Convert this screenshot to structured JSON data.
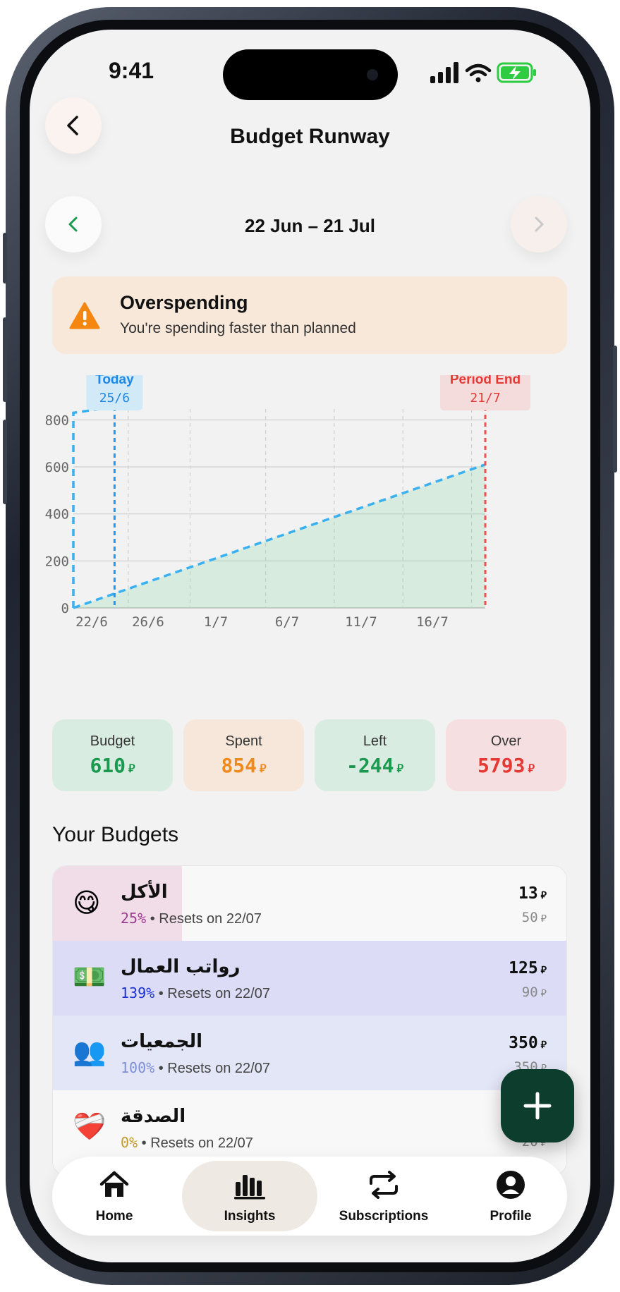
{
  "status_bar": {
    "time": "9:41"
  },
  "header": {
    "title": "Budget Runway"
  },
  "period": {
    "label": "22 Jun – 21 Jul"
  },
  "alert": {
    "title": "Overspending",
    "message": "You're spending faster than planned",
    "color": "#f8e8da"
  },
  "chart_data": {
    "type": "line",
    "x_ticks": [
      "22/6",
      "26/6",
      "1/7",
      "6/7",
      "11/7",
      "16/7"
    ],
    "y_ticks": [
      0,
      200,
      400,
      600,
      800
    ],
    "ylim": [
      0,
      900
    ],
    "markers": {
      "today": {
        "label": "Today",
        "date": "25/6"
      },
      "period_end": {
        "label": "Period End",
        "date": "21/7"
      }
    },
    "series": [
      {
        "values": [
          [
            0,
            0
          ],
          [
            30,
            610
          ]
        ],
        "color": "#3bb0f0",
        "style": "dashed-area"
      },
      {
        "values": [
          [
            0,
            830
          ],
          [
            3,
            855
          ]
        ],
        "color": "#3bb0f0",
        "style": "dashed"
      }
    ]
  },
  "stats": [
    {
      "label": "Budget",
      "value": "610",
      "currency": "⃁",
      "color": "#1a9a4f",
      "bg": "#d8ece2"
    },
    {
      "label": "Spent",
      "value": "854",
      "currency": "⃁",
      "color": "#f08a1c",
      "bg": "#f6e7da"
    },
    {
      "label": "Left",
      "value": "-244",
      "currency": "⃁",
      "color": "#1a9a4f",
      "bg": "#d8ece2"
    },
    {
      "label": "Over",
      "value": "5793",
      "currency": "⃁",
      "color": "#e53935",
      "bg": "#f5dfe0"
    }
  ],
  "budgets_section": {
    "title": "Your Budgets"
  },
  "budgets": [
    {
      "emoji": "😋",
      "name": "الأكل",
      "percent": "25%",
      "percent_color": "#9b3c8f",
      "resets": "• Resets on 22/07",
      "spent": "13",
      "budget": "50",
      "fill": 0.25,
      "fill_color": "#f1dde8",
      "bg": "#f8f8f8"
    },
    {
      "emoji": "💵",
      "name": "رواتب العمال",
      "percent": "139%",
      "percent_color": "#1a2fd6",
      "resets": "• Resets on 22/07",
      "spent": "125",
      "budget": "90",
      "fill": 1.0,
      "fill_color": "#dcdcf6",
      "bg": "#dcdcf6"
    },
    {
      "emoji": "👥",
      "name": "الجمعيات",
      "percent": "100%",
      "percent_color": "#7f8fd6",
      "resets": "• Resets on 22/07",
      "spent": "350",
      "budget": "350",
      "fill": 1.0,
      "fill_color": "#e3e6f6",
      "bg": "#e3e6f6"
    },
    {
      "emoji": "❤️‍🩹",
      "name": "الصدقة",
      "percent": "0%",
      "percent_color": "#c49a2a",
      "resets": "• Resets on 22/07",
      "spent": "",
      "budget": "20",
      "fill": 0,
      "fill_color": "#f8f8f8",
      "bg": "#f8f8f8"
    }
  ],
  "tabbar": {
    "items": [
      {
        "label": "Home"
      },
      {
        "label": "Insights"
      },
      {
        "label": "Subscriptions"
      },
      {
        "label": "Profile"
      }
    ],
    "active": "Insights"
  }
}
